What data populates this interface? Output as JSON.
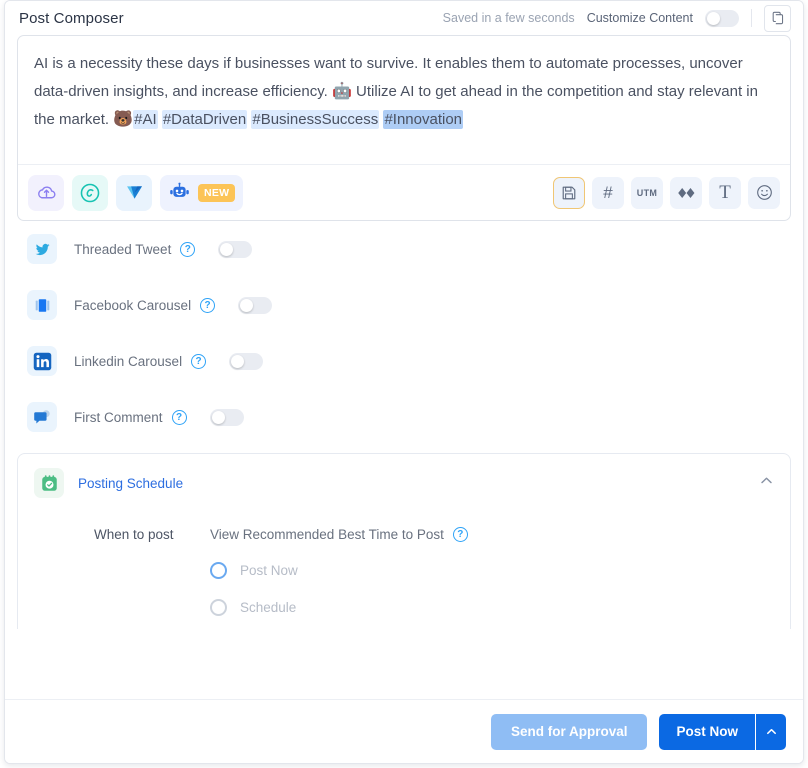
{
  "header": {
    "title": "Post Composer",
    "saved_status": "Saved in a few seconds",
    "customize_label": "Customize Content",
    "customize_toggle_state": "off",
    "copy_icon": "copy-icon"
  },
  "editor": {
    "text_part1": "AI is a necessity these days if businesses want to survive. It enables them to automate processes, uncover data-driven insights, and increase efficiency. ",
    "emoji1": "🤖",
    "text_part2": " Utilize AI to get ahead in the competition and stay relevant in the market. ",
    "emoji2": "🐻",
    "hashtags": [
      {
        "text": "#AI",
        "selected": false
      },
      {
        "text": "#DataDriven",
        "selected": false
      },
      {
        "text": "#BusinessSuccess",
        "selected": false
      },
      {
        "text": "#Innovation",
        "selected": true
      }
    ]
  },
  "toolbar": {
    "left": [
      {
        "name": "cloud-upload-icon",
        "label": "Upload"
      },
      {
        "name": "canva-icon",
        "label": "Canva"
      },
      {
        "name": "vistacreate-icon",
        "label": "VistaCreate"
      },
      {
        "name": "ai-robot-icon",
        "label": "AI Assistant",
        "badge": "NEW"
      }
    ],
    "right": [
      {
        "name": "save-draft-icon",
        "label": "Save"
      },
      {
        "name": "hashtag-icon",
        "label": "#"
      },
      {
        "name": "utm-icon",
        "label": "UTM"
      },
      {
        "name": "link-shortener-icon",
        "label": "Shorten link"
      },
      {
        "name": "text-format-icon",
        "label": "T"
      },
      {
        "name": "emoji-icon",
        "label": "Emoji"
      }
    ]
  },
  "options": [
    {
      "icon": "twitter-icon",
      "label": "Threaded Tweet",
      "help": "?",
      "toggle": "off"
    },
    {
      "icon": "facebook-carousel-icon",
      "label": "Facebook Carousel",
      "help": "?",
      "toggle": "off"
    },
    {
      "icon": "linkedin-icon",
      "label": "Linkedin Carousel",
      "help": "?",
      "toggle": "off"
    },
    {
      "icon": "first-comment-icon",
      "label": "First Comment",
      "help": "?",
      "toggle": "off"
    }
  ],
  "schedule": {
    "icon": "calendar-check-icon",
    "title": "Posting Schedule",
    "collapse_icon": "chevron-up-icon",
    "when_label": "When to post",
    "best_time_link": "View Recommended Best Time to Post",
    "help": "?",
    "radios": [
      {
        "label": "Post Now",
        "selected": true
      },
      {
        "label": "Schedule",
        "selected": false
      }
    ]
  },
  "footer": {
    "send_approval_label": "Send for Approval",
    "post_now_label": "Post Now",
    "caret_icon": "chevron-up-icon"
  },
  "colors": {
    "primary_blue": "#0b69e3",
    "light_blue": "#8fbdf4",
    "highlight": "#dbeafe",
    "selection": "#aecdf5",
    "badge_amber": "#fcc457",
    "green": "#49b87c"
  }
}
